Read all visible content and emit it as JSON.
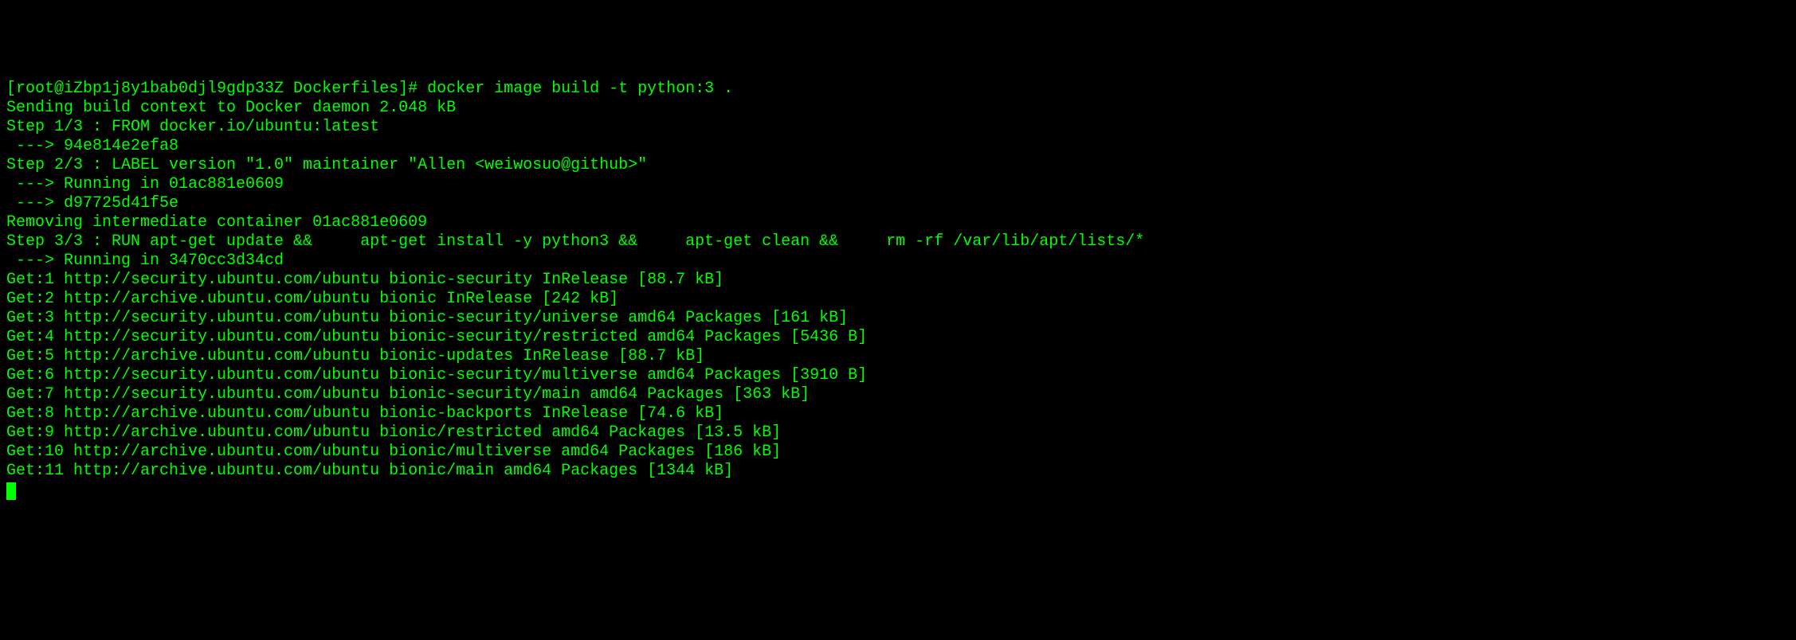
{
  "lines": [
    "[root@iZbp1j8y1bab0djl9gdp33Z Dockerfiles]# docker image build -t python:3 .",
    "Sending build context to Docker daemon 2.048 kB",
    "Step 1/3 : FROM docker.io/ubuntu:latest",
    " ---> 94e814e2efa8",
    "Step 2/3 : LABEL version \"1.0\" maintainer \"Allen <weiwosuo@github>\"",
    " ---> Running in 01ac881e0609",
    " ---> d97725d41f5e",
    "Removing intermediate container 01ac881e0609",
    "Step 3/3 : RUN apt-get update &&     apt-get install -y python3 &&     apt-get clean &&     rm -rf /var/lib/apt/lists/*",
    " ---> Running in 3470cc3d34cd",
    "",
    "Get:1 http://security.ubuntu.com/ubuntu bionic-security InRelease [88.7 kB]",
    "Get:2 http://archive.ubuntu.com/ubuntu bionic InRelease [242 kB]",
    "Get:3 http://security.ubuntu.com/ubuntu bionic-security/universe amd64 Packages [161 kB]",
    "Get:4 http://security.ubuntu.com/ubuntu bionic-security/restricted amd64 Packages [5436 B]",
    "Get:5 http://archive.ubuntu.com/ubuntu bionic-updates InRelease [88.7 kB]",
    "Get:6 http://security.ubuntu.com/ubuntu bionic-security/multiverse amd64 Packages [3910 B]",
    "Get:7 http://security.ubuntu.com/ubuntu bionic-security/main amd64 Packages [363 kB]",
    "Get:8 http://archive.ubuntu.com/ubuntu bionic-backports InRelease [74.6 kB]",
    "Get:9 http://archive.ubuntu.com/ubuntu bionic/restricted amd64 Packages [13.5 kB]",
    "Get:10 http://archive.ubuntu.com/ubuntu bionic/multiverse amd64 Packages [186 kB]",
    "Get:11 http://archive.ubuntu.com/ubuntu bionic/main amd64 Packages [1344 kB]"
  ]
}
